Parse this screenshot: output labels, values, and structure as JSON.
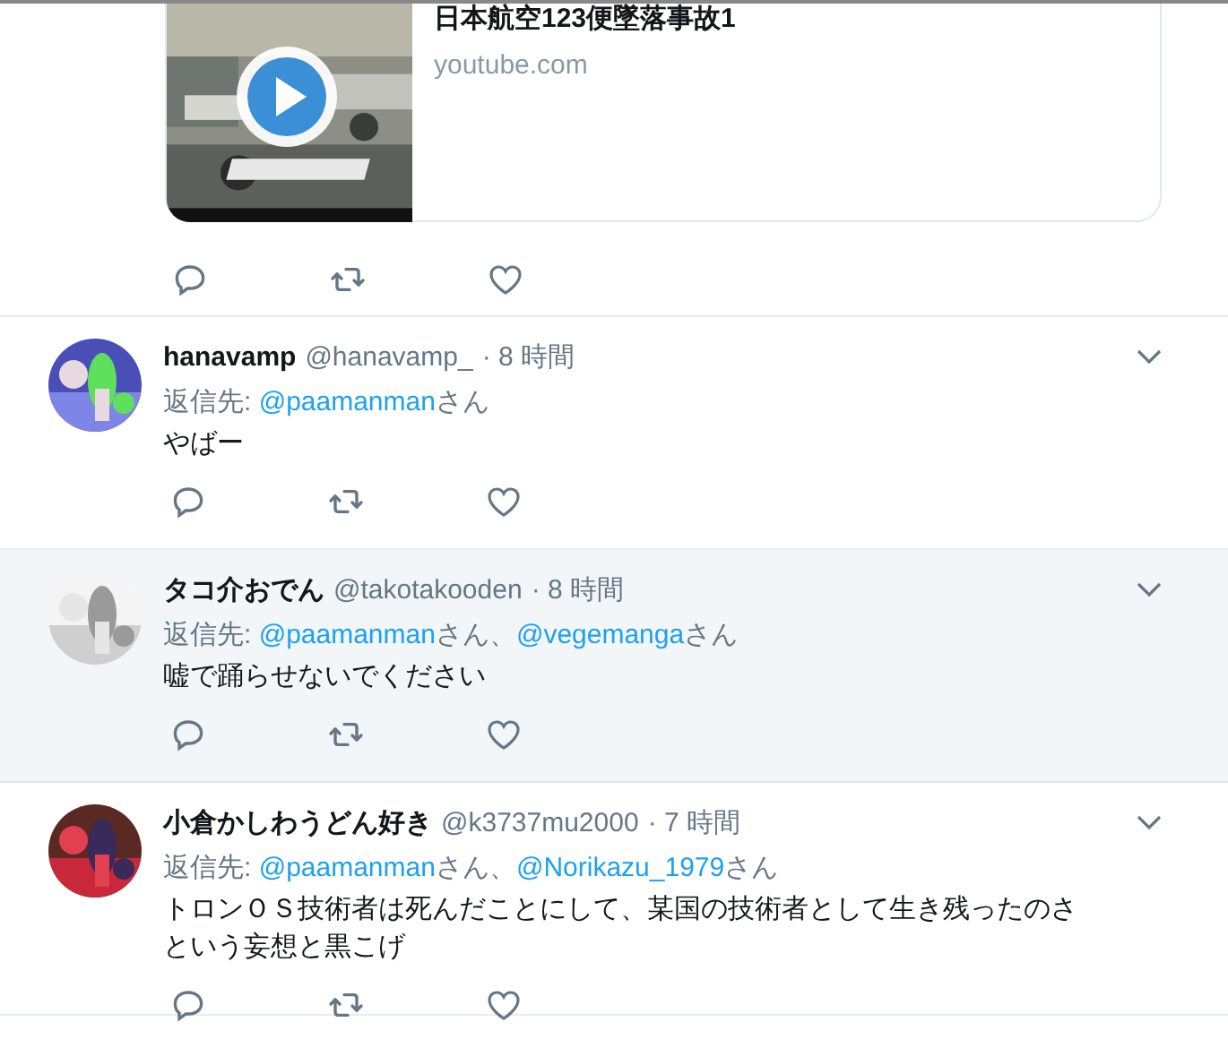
{
  "card": {
    "title": "日本航空123便墜落事故1",
    "domain": "youtube.com"
  },
  "tweets": [
    {
      "name": "hanavamp",
      "handle": "@hanavamp_",
      "time": "· 8 時間",
      "highlighted": false,
      "reply_label": "返信先:",
      "reply_to": [
        {
          "handle": "@paamanman",
          "suffix": "さん"
        }
      ],
      "text": [
        "やばー"
      ]
    },
    {
      "name": "タコ介おでん",
      "handle": "@takotakooden",
      "time": "· 8 時間",
      "highlighted": true,
      "reply_label": "返信先:",
      "reply_to": [
        {
          "handle": "@paamanman",
          "suffix": "さん、"
        },
        {
          "handle": "@vegemanga",
          "suffix": "さん"
        }
      ],
      "text": [
        "嘘で踊らせないでください"
      ]
    },
    {
      "name": "小倉かしわうどん好き",
      "handle": "@k3737mu2000",
      "time": "· 7 時間",
      "highlighted": false,
      "reply_label": "返信先:",
      "reply_to": [
        {
          "handle": "@paamanman",
          "suffix": "さん、"
        },
        {
          "handle": "@Norikazu_1979",
          "suffix": "さん"
        }
      ],
      "text": [
        "トロンＯＳ技術者は死んだことにして、某国の技術者として生き残ったのさ",
        "という妄想と黒こげ"
      ]
    }
  ]
}
